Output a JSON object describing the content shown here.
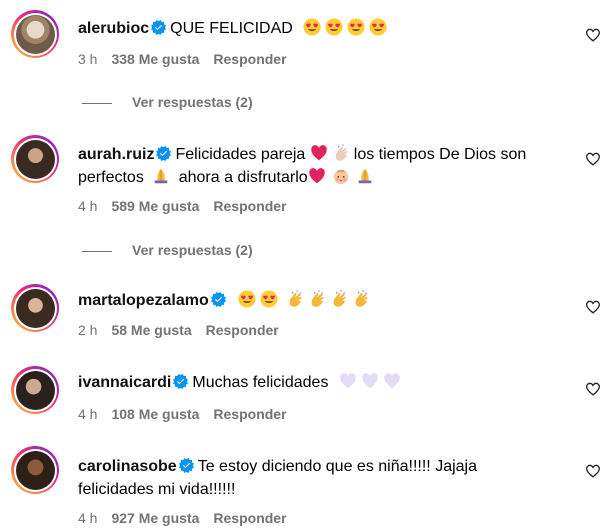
{
  "comments": [
    {
      "username": "alerubioc",
      "text": "QUE FELICIDAD",
      "time": "3 h",
      "likes": "338 Me gusta",
      "reply": "Responder",
      "replies": "Ver respuestas (2)"
    },
    {
      "username": "aurah.ruiz",
      "text1": "Felicidades pareja",
      "text2": "los tiempos De Dios son perfectos",
      "text3": "ahora a disfrutarlo",
      "time": "4 h",
      "likes": "589 Me gusta",
      "reply": "Responder",
      "replies": "Ver respuestas (2)"
    },
    {
      "username": "martalopezalamo",
      "time": "2 h",
      "likes": "58 Me gusta",
      "reply": "Responder"
    },
    {
      "username": "ivannaicardi",
      "text": "Muchas felicidades",
      "time": "4 h",
      "likes": "108 Me gusta",
      "reply": "Responder"
    },
    {
      "username": "carolinasobe",
      "text1": "Te estoy diciendo que es niña!!!!! Jajaja",
      "text2": "felicidades mi vida!!!!!!",
      "time": "4 h",
      "likes": "927 Me gusta",
      "reply": "Responder"
    }
  ],
  "colors": {
    "verified": "#0095f6",
    "muted": "#737373"
  }
}
